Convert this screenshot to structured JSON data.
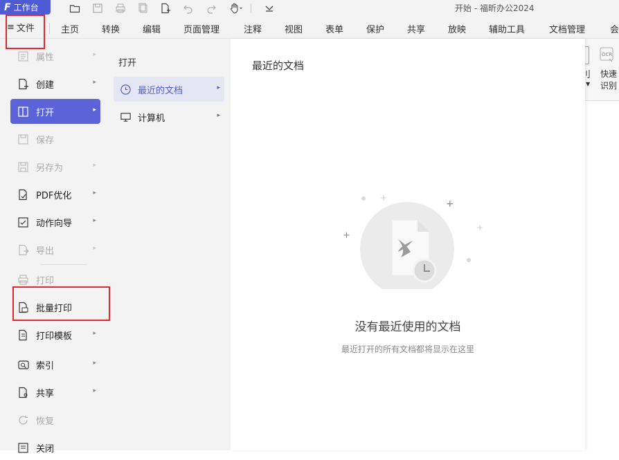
{
  "titlebar": {
    "workbench_label": "工作台",
    "app_title": "开始 - 福昕办公2024"
  },
  "ribbon_tabs": [
    "主页",
    "转换",
    "编辑",
    "页面管理",
    "注释",
    "视图",
    "表单",
    "保护",
    "共享",
    "放映",
    "辅助工具",
    "文档管理",
    "会"
  ],
  "file_tab": {
    "label": "文件"
  },
  "ribbon_right": {
    "ocr_label": "快速识别",
    "partial_label": "刂"
  },
  "left_menu": {
    "items": [
      {
        "label": "属性",
        "icon": "properties-icon",
        "state": "disabled",
        "arrow": true
      },
      {
        "label": "创建",
        "icon": "create-icon",
        "state": "normal",
        "arrow": true
      },
      {
        "label": "打开",
        "icon": "open-icon",
        "state": "active",
        "arrow": true
      },
      {
        "label": "保存",
        "icon": "save-icon",
        "state": "disabled",
        "arrow": false
      },
      {
        "label": "另存为",
        "icon": "save-as-icon",
        "state": "disabled",
        "arrow": true
      },
      {
        "label": "PDF优化",
        "icon": "pdf-optimize-icon",
        "state": "normal",
        "arrow": true
      },
      {
        "label": "动作向导",
        "icon": "action-wizard-icon",
        "state": "normal",
        "arrow": true
      },
      {
        "label": "导出",
        "icon": "export-icon",
        "state": "disabled",
        "arrow": true
      },
      {
        "label": "打印",
        "icon": "print-icon",
        "state": "disabled",
        "arrow": false
      },
      {
        "label": "批量打印",
        "icon": "batch-print-icon",
        "state": "normal",
        "arrow": false
      },
      {
        "label": "打印模板",
        "icon": "print-template-icon",
        "state": "normal",
        "arrow": true
      },
      {
        "label": "索引",
        "icon": "index-icon",
        "state": "normal",
        "arrow": true
      },
      {
        "label": "共享",
        "icon": "share-icon",
        "state": "normal",
        "arrow": true
      },
      {
        "label": "恢复",
        "icon": "restore-icon",
        "state": "disabled",
        "arrow": false
      },
      {
        "label": "关闭",
        "icon": "close-doc-icon",
        "state": "normal",
        "arrow": false
      }
    ]
  },
  "open_submenu": {
    "title": "打开",
    "items": [
      {
        "label": "最近的文档",
        "icon": "clock-icon",
        "selected": true
      },
      {
        "label": "计算机",
        "icon": "computer-icon",
        "selected": false
      }
    ]
  },
  "main_panel": {
    "title": "最近的文档",
    "empty_title": "没有最近使用的文档",
    "empty_subtitle": "最近打开的所有文档都将显示在这里"
  },
  "arrow_glyph": "▸",
  "colors": {
    "accent": "#5a64d8",
    "highlight_border": "#e5262b",
    "menu_bg": "#f3f3f3"
  }
}
